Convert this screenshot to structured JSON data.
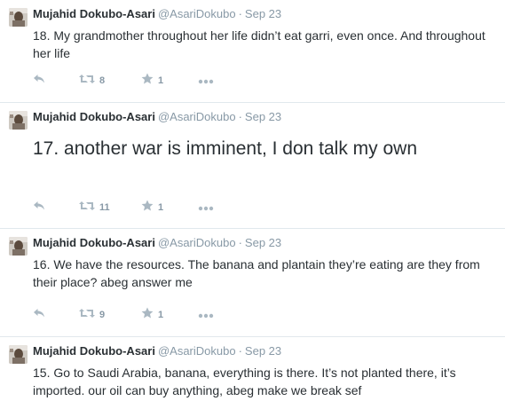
{
  "tweets": [
    {
      "fullname": "Mujahid Dokubo-Asari",
      "username": "@AsariDokubo",
      "separator": "·",
      "time": "Sep 23",
      "text": "18. My grandmother throughout her life didn’t eat garri, even once. And throughout her life",
      "retweets": "8",
      "favorites": "1"
    },
    {
      "fullname": "Mujahid Dokubo-Asari",
      "username": "@AsariDokubo",
      "separator": "·",
      "time": "Sep 23",
      "text": "17. another war is imminent, I don talk my own",
      "retweets": "11",
      "favorites": "1"
    },
    {
      "fullname": "Mujahid Dokubo-Asari",
      "username": "@AsariDokubo",
      "separator": "·",
      "time": "Sep 23",
      "text": "16. We have the resources. The banana and plantain they’re eating are they from their place? abeg answer me",
      "retweets": "9",
      "favorites": "1"
    },
    {
      "fullname": "Mujahid Dokubo-Asari",
      "username": "@AsariDokubo",
      "separator": "·",
      "time": "Sep 23",
      "text": "15. Go to Saudi Arabia, banana, everything is there. It’s not planted there, it’s imported. our oil can buy anything, abeg make we break sef"
    }
  ],
  "icons": {
    "reply": "reply-icon",
    "retweet": "retweet-icon",
    "favorite": "star-icon",
    "more": "more-icon"
  },
  "colors": {
    "name": "#292f33",
    "meta": "#8899a6",
    "icon": "#aab8c2",
    "divider": "#e1e8ed"
  }
}
